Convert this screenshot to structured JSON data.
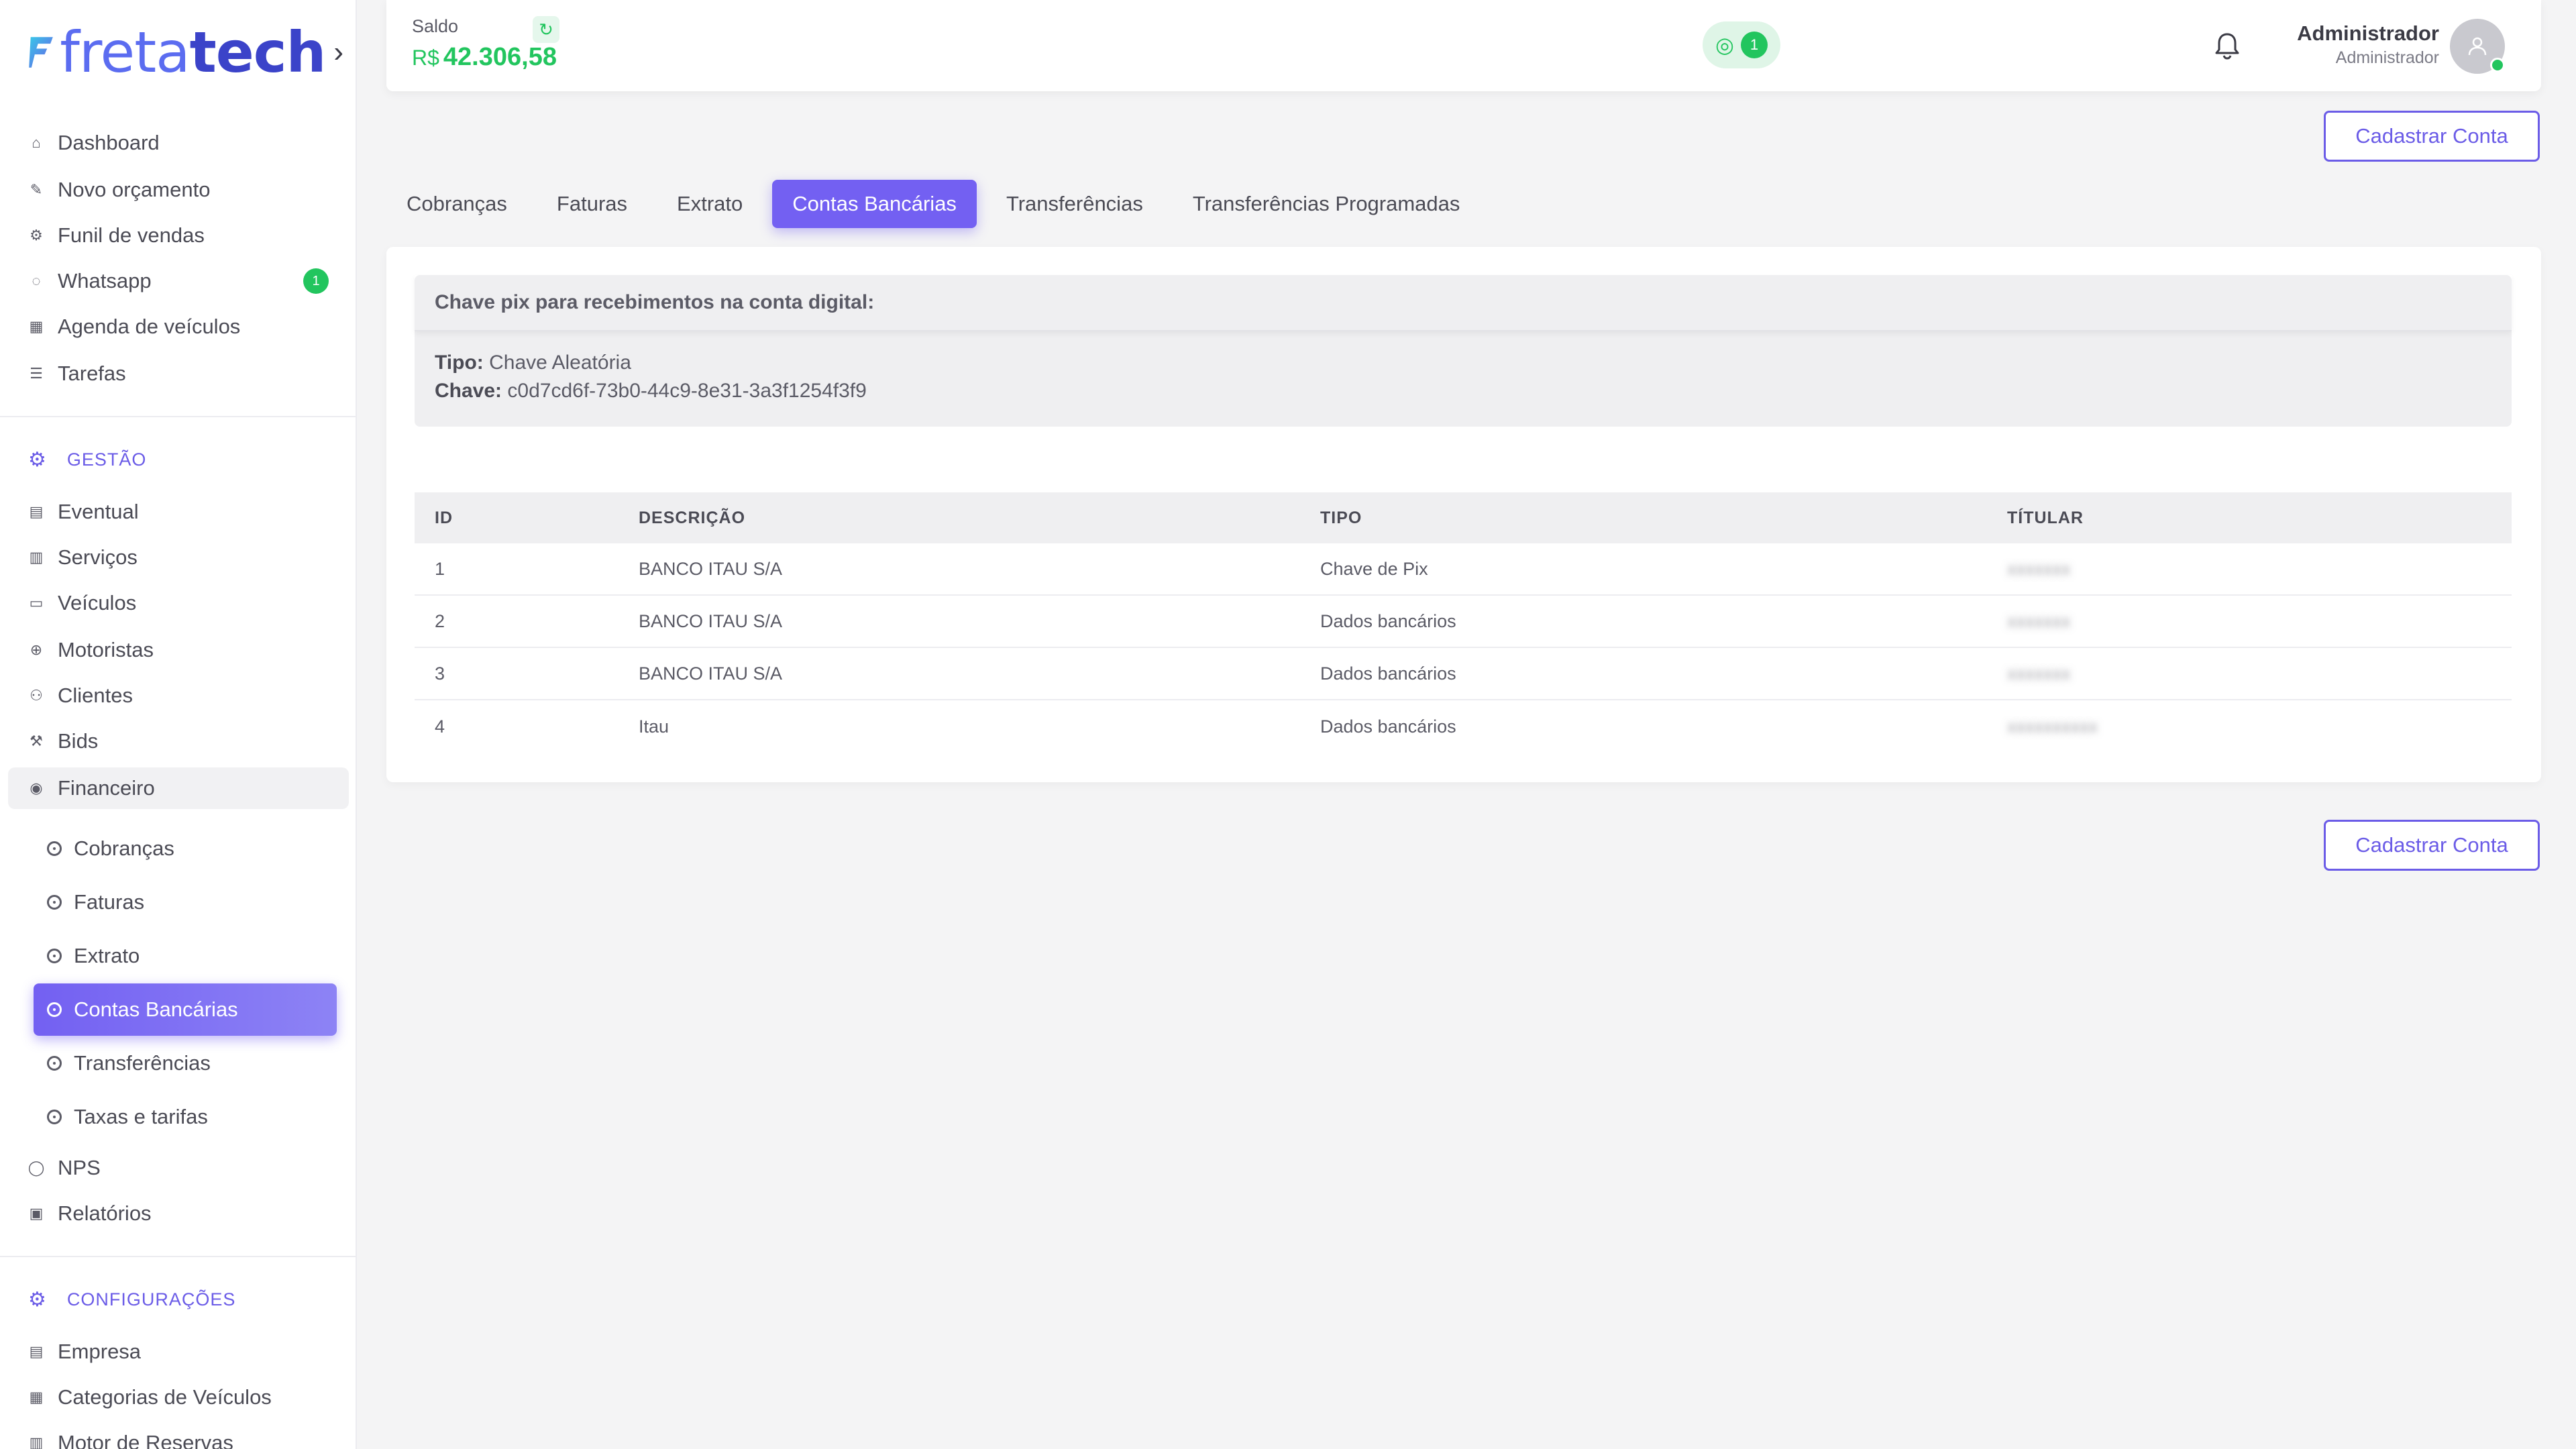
{
  "app": {
    "logo_text_a": "freta",
    "logo_text_b": "tech"
  },
  "sidebar": {
    "main_items": [
      {
        "label": "Dashboard",
        "icon": "home-icon"
      },
      {
        "label": "Novo orçamento",
        "icon": "edit-icon"
      },
      {
        "label": "Funil de vendas",
        "icon": "funnel-icon"
      },
      {
        "label": "Whatsapp",
        "icon": "whatsapp-icon",
        "badge": "1"
      },
      {
        "label": "Agenda de veículos",
        "icon": "calendar-icon"
      },
      {
        "label": "Tarefas",
        "icon": "list-icon"
      }
    ],
    "gestao_title": "GESTÃO",
    "gestao_items": [
      {
        "label": "Eventual",
        "icon": "document-icon"
      },
      {
        "label": "Serviços",
        "icon": "receipt-icon"
      },
      {
        "label": "Veículos",
        "icon": "bus-icon"
      },
      {
        "label": "Motoristas",
        "icon": "steering-wheel-icon"
      },
      {
        "label": "Clientes",
        "icon": "users-icon"
      },
      {
        "label": "Bids",
        "icon": "gavel-icon"
      },
      {
        "label": "Financeiro",
        "icon": "money-icon"
      }
    ],
    "financeiro_sub": [
      {
        "label": "Cobranças"
      },
      {
        "label": "Faturas"
      },
      {
        "label": "Extrato"
      },
      {
        "label": "Contas Bancárias",
        "active": true
      },
      {
        "label": "Transferências"
      },
      {
        "label": "Taxas e tarifas"
      }
    ],
    "after_items": [
      {
        "label": "NPS",
        "icon": "chat-icon"
      },
      {
        "label": "Relatórios",
        "icon": "report-icon"
      }
    ],
    "config_title": "CONFIGURAÇÕES",
    "config_items": [
      {
        "label": "Empresa",
        "icon": "briefcase-icon"
      },
      {
        "label": "Categorias de Veículos",
        "icon": "grid-icon"
      },
      {
        "label": "Motor de Reservas",
        "icon": "table-icon"
      }
    ]
  },
  "topbar": {
    "saldo_label": "Saldo",
    "saldo_currency": "R$",
    "saldo_value": "42.306,58",
    "whatsapp_count": "1",
    "user_name": "Administrador",
    "user_role": "Administrador"
  },
  "actions": {
    "register_label": "Cadastrar Conta"
  },
  "tabs": [
    {
      "label": "Cobranças"
    },
    {
      "label": "Faturas"
    },
    {
      "label": "Extrato"
    },
    {
      "label": "Contas Bancárias",
      "active": true
    },
    {
      "label": "Transferências"
    },
    {
      "label": "Transferências Programadas"
    }
  ],
  "pix": {
    "heading": "Chave pix para recebimentos na conta digital:",
    "tipo_label": "Tipo:",
    "tipo_value": "Chave Aleatória",
    "chave_label": "Chave:",
    "chave_value": "c0d7cd6f-73b0-44c9-8e31-3a3f1254f3f9"
  },
  "table": {
    "headers": [
      "ID",
      "DESCRIÇÃO",
      "TIPO",
      "TÍTULAR"
    ],
    "rows": [
      {
        "id": "1",
        "descricao": "BANCO ITAU S/A",
        "tipo": "Chave de Pix",
        "titular": "xxxxxxx"
      },
      {
        "id": "2",
        "descricao": "BANCO ITAU S/A",
        "tipo": "Dados bancários",
        "titular": "xxxxxxx"
      },
      {
        "id": "3",
        "descricao": "BANCO ITAU S/A",
        "tipo": "Dados bancários",
        "titular": "xxxxxxx"
      },
      {
        "id": "4",
        "descricao": "Itau",
        "tipo": "Dados bancários",
        "titular": "xxxxxxxxxx"
      }
    ]
  },
  "colors": {
    "accent": "#7360f2",
    "success": "#22c55e",
    "background": "#f4f4f5"
  }
}
